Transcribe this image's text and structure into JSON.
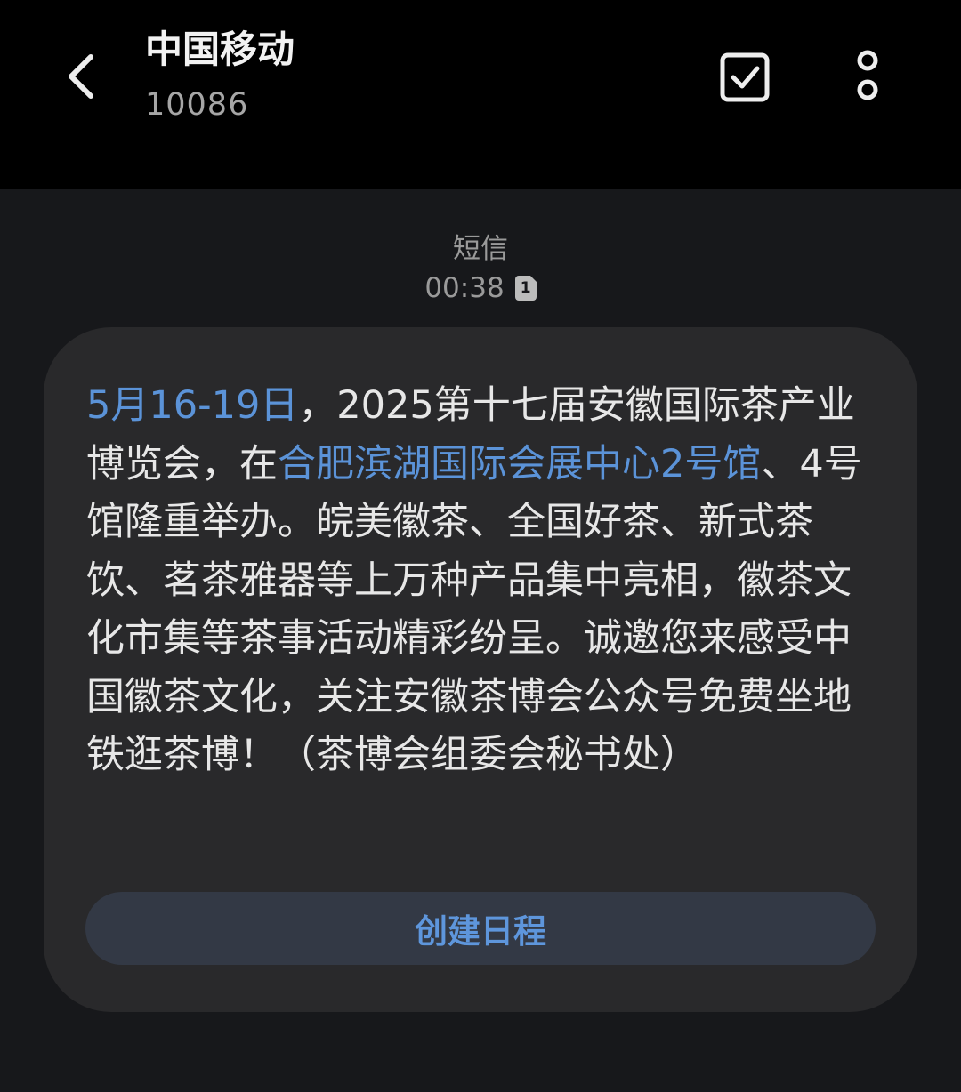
{
  "header": {
    "contact_name": "中国移动",
    "contact_number": "10086",
    "back_icon": "chevron-left-icon",
    "select_icon": "checkbox-icon",
    "more_icon": "more-vertical-icon"
  },
  "message_meta": {
    "type_label": "短信",
    "time": "00:38",
    "sim_badge": "1"
  },
  "message": {
    "date_link": "5月16-19日",
    "text_part1": "，2025第十七届安徽国际茶产业博览会，在",
    "venue_link": "合肥滨湖国际会展中心2号馆",
    "text_part2": "、4号馆隆重举办。皖美徽茶、全国好茶、新式茶饮、茗茶雅器等上万种产品集中亮相，徽茶文化市集等茶事活动精彩纷呈。诚邀您来感受中国徽茶文化，关注安徽茶博会公众号免费坐地铁逛茶博！（茶博会组委会秘书处）"
  },
  "actions": {
    "create_schedule": "创建日程"
  },
  "colors": {
    "link": "#5b93d8",
    "bubble": "#29292b",
    "header_bg": "#000000",
    "page_bg": "#17181b"
  }
}
